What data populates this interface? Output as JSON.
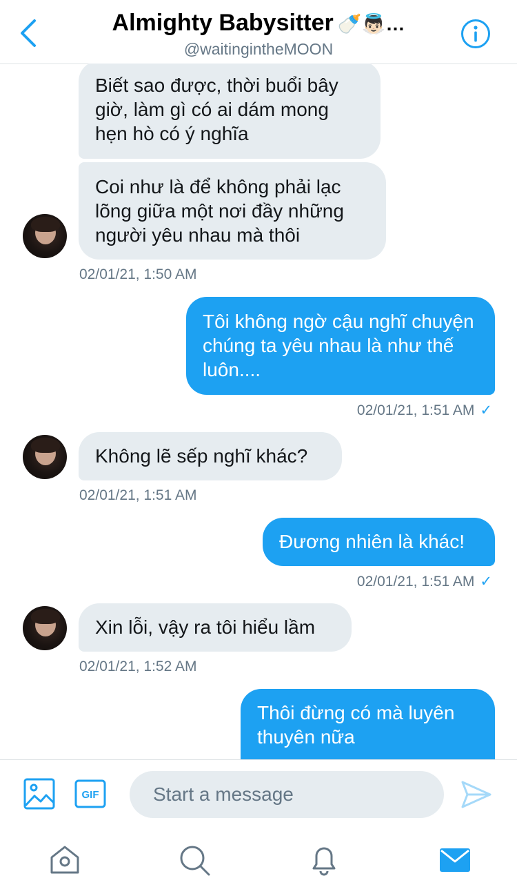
{
  "header": {
    "title": "Almighty Babysitter",
    "title_emoji": "🍼👼🏻…",
    "handle": "@waitingintheMOON"
  },
  "messages": [
    {
      "direction": "in",
      "text": "Biết sao được, thời buổi bây giờ, làm gì có ai dám mong hẹn hò có ý nghĩa"
    },
    {
      "direction": "in",
      "text": "Coi như là để không phải lạc lõng giữa một nơi đầy những người yêu nhau mà thôi",
      "timestamp": "02/01/21, 1:50 AM"
    },
    {
      "direction": "out",
      "text": "Tôi không ngờ cậu nghĩ chuyện chúng ta yêu nhau là như thế luôn....",
      "timestamp": "02/01/21, 1:51 AM",
      "status": "✓"
    },
    {
      "direction": "in",
      "text": "Không lẽ sếp nghĩ khác?",
      "timestamp": "02/01/21, 1:51 AM"
    },
    {
      "direction": "out",
      "text": "Đương nhiên là khác!",
      "timestamp": "02/01/21, 1:51 AM",
      "status": "✓"
    },
    {
      "direction": "in",
      "text": "Xin lỗi, vậy ra tôi hiểu lầm",
      "timestamp": "02/01/21, 1:52 AM"
    },
    {
      "direction": "out",
      "text": "Thôi đừng có mà luyên thuyên nữa"
    }
  ],
  "composer": {
    "placeholder": "Start a message",
    "gif_label": "GIF"
  },
  "colors": {
    "accent": "#1da1f2",
    "incoming_bubble": "#e6ecf0",
    "secondary_text": "#657786"
  },
  "icons": {
    "back": "chevron-left-icon",
    "info": "info-icon",
    "image": "image-icon",
    "gif": "gif-icon",
    "send": "send-icon",
    "tabs": [
      "home-icon",
      "search-icon",
      "notifications-icon",
      "messages-icon"
    ]
  }
}
